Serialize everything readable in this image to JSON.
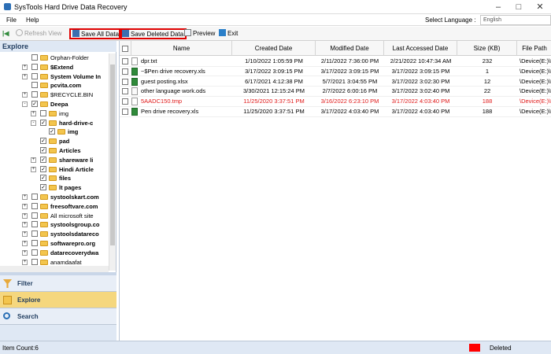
{
  "window": {
    "title": "SysTools Hard Drive Data Recovery"
  },
  "menu": {
    "file": "File",
    "help": "Help",
    "language_label": "Select Language :",
    "language_value": "English"
  },
  "toolbar": {
    "refresh": "Refresh View",
    "save_all": "Save All Data",
    "save_deleted": "Save Deleted Data",
    "preview": "Preview",
    "exit": "Exit"
  },
  "left": {
    "header": "Explore",
    "tree": [
      {
        "label": "Orphan-Folder",
        "bold": false,
        "checked": false,
        "indent": 0,
        "expand": ""
      },
      {
        "label": "$Extend",
        "bold": true,
        "checked": false,
        "indent": 0,
        "expand": "+"
      },
      {
        "label": "System Volume In",
        "bold": true,
        "checked": false,
        "indent": 0,
        "expand": "+"
      },
      {
        "label": "pcvita.com",
        "bold": true,
        "checked": false,
        "indent": 0,
        "expand": ""
      },
      {
        "label": "$RECYCLE.BIN",
        "bold": false,
        "checked": false,
        "indent": 0,
        "expand": "+"
      },
      {
        "label": "Deepa",
        "bold": true,
        "checked": true,
        "indent": 0,
        "expand": "-"
      },
      {
        "label": "img",
        "bold": false,
        "checked": false,
        "indent": 1,
        "expand": "+"
      },
      {
        "label": "hard-drive-c",
        "bold": true,
        "checked": true,
        "indent": 1,
        "expand": "-"
      },
      {
        "label": "img",
        "bold": true,
        "checked": true,
        "indent": 2,
        "expand": ""
      },
      {
        "label": "pad",
        "bold": true,
        "checked": true,
        "indent": 1,
        "expand": ""
      },
      {
        "label": "Articles",
        "bold": true,
        "checked": true,
        "indent": 1,
        "expand": ""
      },
      {
        "label": "shareware li",
        "bold": true,
        "checked": true,
        "indent": 1,
        "expand": "+"
      },
      {
        "label": "Hindi Article",
        "bold": true,
        "checked": true,
        "indent": 1,
        "expand": "+"
      },
      {
        "label": "files",
        "bold": true,
        "checked": true,
        "indent": 1,
        "expand": ""
      },
      {
        "label": "lt pages",
        "bold": true,
        "checked": true,
        "indent": 1,
        "expand": ""
      },
      {
        "label": "systoolskart.com",
        "bold": true,
        "checked": false,
        "indent": 0,
        "expand": "+"
      },
      {
        "label": "freesoftvare.com",
        "bold": true,
        "checked": false,
        "indent": 0,
        "expand": "+"
      },
      {
        "label": "All microsoft site",
        "bold": false,
        "checked": false,
        "indent": 0,
        "expand": "+"
      },
      {
        "label": "systoolsgroup.co",
        "bold": true,
        "checked": false,
        "indent": 0,
        "expand": "+"
      },
      {
        "label": "systoolsdatareco",
        "bold": true,
        "checked": false,
        "indent": 0,
        "expand": "+"
      },
      {
        "label": "softwarepro.org",
        "bold": true,
        "checked": false,
        "indent": 0,
        "expand": "+"
      },
      {
        "label": "datarecoverydwa",
        "bold": true,
        "checked": false,
        "indent": 0,
        "expand": "+"
      },
      {
        "label": "anamdaafat",
        "bold": false,
        "checked": false,
        "indent": 0,
        "expand": "+"
      }
    ],
    "nav": {
      "filter": "Filter",
      "explore": "Explore",
      "search": "Search"
    }
  },
  "grid": {
    "columns": [
      "Name",
      "Created Date",
      "Modified Date",
      "Last Accessed Date",
      "Size (KB)",
      "File Path"
    ],
    "rows": [
      {
        "icon": "file",
        "name": "dpr.txt",
        "created": "1/10/2022 1:05:59 PM",
        "modified": "2/11/2022 7:36:00 PM",
        "accessed": "2/21/2022 10:47:34 AM",
        "size": "232",
        "path": "\\Device(E:)\\Partition(NTF",
        "deleted": false
      },
      {
        "icon": "xls",
        "name": "~$Pen drive recovery.xls",
        "created": "3/17/2022 3:09:15 PM",
        "modified": "3/17/2022 3:09:15 PM",
        "accessed": "3/17/2022 3:09:15 PM",
        "size": "1",
        "path": "\\Device(E:)\\Partition(NTF",
        "deleted": false
      },
      {
        "icon": "xls",
        "name": "guest posting.xlsx",
        "created": "6/17/2021 4:12:38 PM",
        "modified": "5/7/2021 3:04:55 PM",
        "accessed": "3/17/2022 3:02:30 PM",
        "size": "12",
        "path": "\\Device(E:)\\Partition(NTF",
        "deleted": false
      },
      {
        "icon": "ods",
        "name": "other language work.ods",
        "created": "3/30/2021 12:15:24 PM",
        "modified": "2/7/2022 6:00:16 PM",
        "accessed": "3/17/2022 3:02:40 PM",
        "size": "22",
        "path": "\\Device(E:)\\Partition(NTF",
        "deleted": false
      },
      {
        "icon": "file",
        "name": "5AADC150.tmp",
        "created": "11/25/2020 3:37:51 PM",
        "modified": "3/16/2022 6:23:10 PM",
        "accessed": "3/17/2022 4:03:40 PM",
        "size": "188",
        "path": "\\Device(E:)\\Partition(NTF",
        "deleted": true
      },
      {
        "icon": "xls",
        "name": "Pen drive recovery.xls",
        "created": "11/25/2020 3:37:51 PM",
        "modified": "3/17/2022 4:03:40 PM",
        "accessed": "3/17/2022 4:03:40 PM",
        "size": "188",
        "path": "\\Device(E:)\\Partition(NTF",
        "deleted": false
      }
    ]
  },
  "status": {
    "item_count": "Item Count:6",
    "legend_deleted": "Deleted"
  },
  "colors": {
    "deleted": "#e01818",
    "highlight_box": "#e00000",
    "panel_header": "#dfe8f4",
    "explore_active": "#f5d77e"
  }
}
